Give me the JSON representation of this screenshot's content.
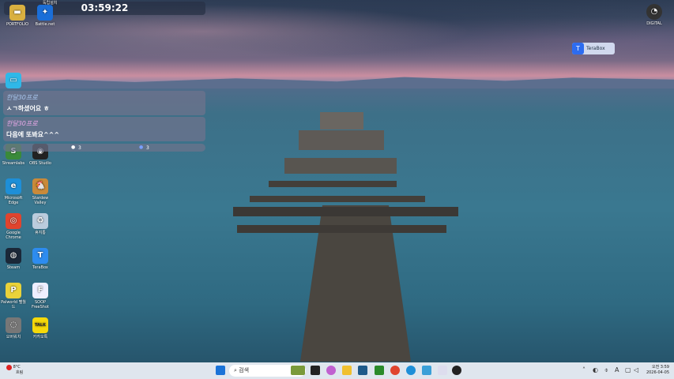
{
  "timer": "03:59:22",
  "chat": [
    {
      "user": "한달30프로",
      "message": "ㅅㄱ하셨어요 ㅎ"
    },
    {
      "user": "한달30프로",
      "message": "다음에 또봐요^^^"
    }
  ],
  "stats": [
    {
      "icon": "viewer-icon",
      "value": "3"
    },
    {
      "icon": "chat-icon",
      "value": "3"
    }
  ],
  "desktop_icons": [
    {
      "label": "PORTFOLIO",
      "color": "#d9b040",
      "glyph": "▬"
    },
    {
      "label": "Battle.net",
      "color": "#1a6ed8",
      "glyph": "✦",
      "badge": "독립설치"
    },
    {
      "label": "",
      "color": "#2fb8e8",
      "glyph": "▭"
    },
    {
      "label": "Streamlabs",
      "color": "#3a8a3a",
      "glyph": "S"
    },
    {
      "label": "OBS Studio",
      "color": "#222",
      "glyph": "◉"
    },
    {
      "label": "Microsoft Edge",
      "color": "#1e8fd8",
      "glyph": "e"
    },
    {
      "label": "Stardew Valley",
      "color": "#c98a3a",
      "glyph": "🐔"
    },
    {
      "label": "Google Chrome",
      "color": "#e0442e",
      "glyph": "◎"
    },
    {
      "label": "휴지통",
      "color": "#bcd",
      "glyph": "♻"
    },
    {
      "label": "Steam",
      "color": "#1b2838",
      "glyph": "◍"
    },
    {
      "label": "TeraBox",
      "color": "#2d8cf0",
      "glyph": "T"
    },
    {
      "label": "Palworld 팰월드",
      "color": "#e9d23a",
      "glyph": "P"
    },
    {
      "label": "SOOP FreeShot",
      "color": "#eef",
      "glyph": "F"
    },
    {
      "label": "오버워치",
      "color": "#777",
      "glyph": "◌"
    },
    {
      "label": "카카오톡",
      "color": "#f5d90a",
      "glyph": "TALK"
    }
  ],
  "right_icon": {
    "label": "DIGITAL"
  },
  "terabox_widget": "TeraBox",
  "taskbar": {
    "weather_temp": "8°C",
    "weather_desc": "흐림",
    "search_placeholder": "검색",
    "time": "오전 3:59",
    "date": "2026-04-05"
  }
}
